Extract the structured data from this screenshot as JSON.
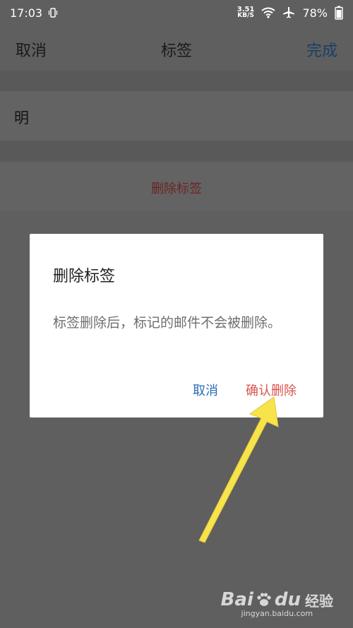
{
  "status_bar": {
    "time": "17:03",
    "net_speed_value": "3.51",
    "net_speed_unit": "KB/S",
    "battery": "78%",
    "icons": [
      "vibrate-icon",
      "wifi-icon",
      "airplane-icon",
      "battery-icon"
    ]
  },
  "nav": {
    "cancel": "取消",
    "title": "标签",
    "done": "完成"
  },
  "tag": {
    "name": "明"
  },
  "delete_row": {
    "label": "删除标签"
  },
  "dialog": {
    "title": "删除标签",
    "message": "标签删除后，标记的邮件不会被删除。",
    "cancel": "取消",
    "confirm": "确认删除"
  },
  "watermark": {
    "logo": "Bai",
    "logo_suffix": "du",
    "sub": "经验",
    "url": "jingyan.baidu.com"
  },
  "colors": {
    "overlay_bg": "#5f5f5f",
    "link_blue": "#2a6bb7",
    "confirm_red": "#d9534f",
    "arrow_yellow": "#f7e34a"
  }
}
